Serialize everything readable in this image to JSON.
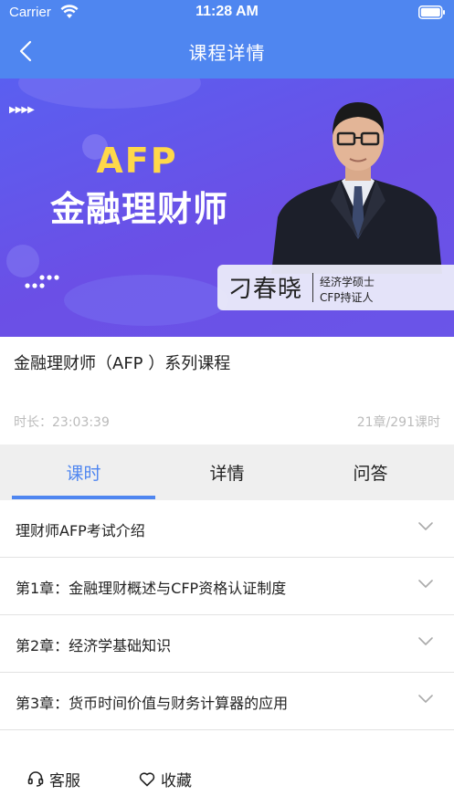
{
  "status_bar": {
    "carrier": "Carrier",
    "time": "11:28 AM"
  },
  "nav": {
    "title": "课程详情",
    "back_icon": "chevron-left-icon"
  },
  "banner": {
    "title_en": "AFP",
    "title_cn": "金融理财师",
    "presenter_name": "刁春晓",
    "presenter_credential_1": "经济学硕士",
    "presenter_credential_2": "CFP持证人"
  },
  "course": {
    "title": "金融理财师（AFP ）系列课程",
    "duration": "时长：23:03:39",
    "counts": "21章/291课时"
  },
  "tabs": [
    {
      "label": "课时",
      "active": true
    },
    {
      "label": "详情",
      "active": false
    },
    {
      "label": "问答",
      "active": false
    }
  ],
  "chapters": [
    {
      "label": "理财师AFP考试介绍"
    },
    {
      "label": "第1章：金融理财概述与CFP资格认证制度"
    },
    {
      "label": "第2章：经济学基础知识"
    },
    {
      "label": "第3章：货币时间价值与财务计算器的应用"
    }
  ],
  "bottom_bar": {
    "service_label": "客服",
    "favorite_label": "收藏",
    "service_icon": "headset-icon",
    "favorite_icon": "heart-icon"
  },
  "colors": {
    "accent": "#4f86f0",
    "banner_gold": "#ffd84a",
    "muted_text": "#bbbbbb"
  }
}
